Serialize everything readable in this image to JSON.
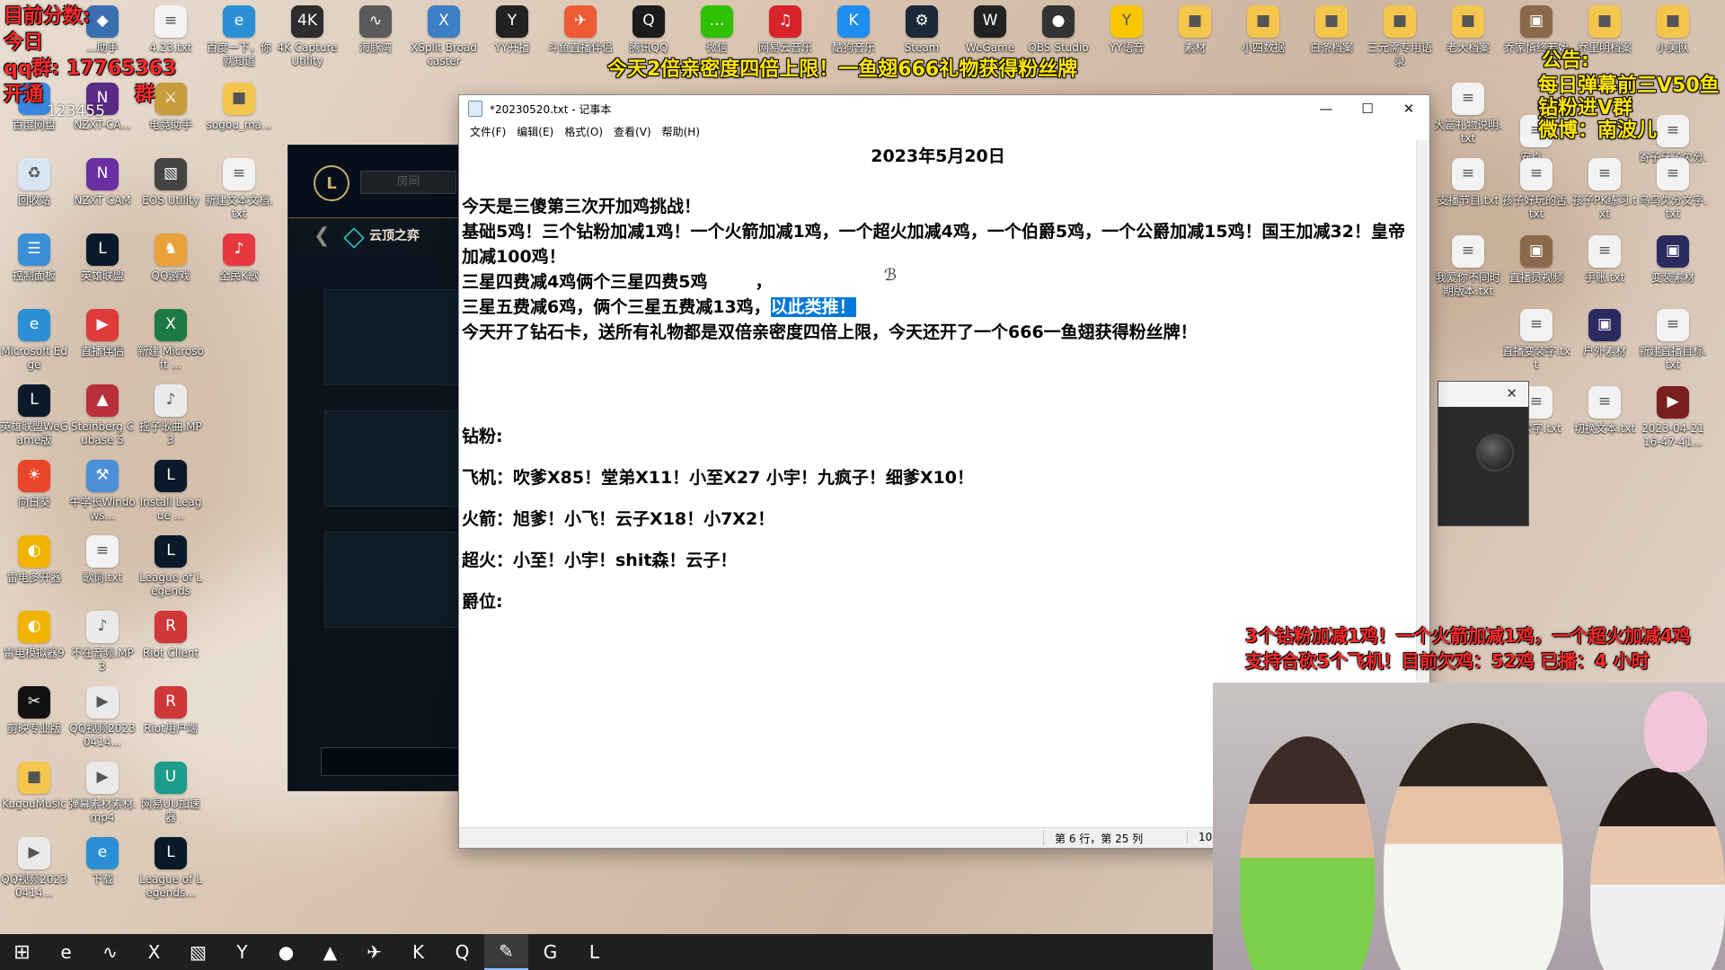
{
  "stream": {
    "score_title": "目前分数:",
    "qq_line": "qq群:   17765363",
    "left_extra_1": "今日",
    "left_extra_2": "开通",
    "left_extra_3": "群",
    "left_number": "123455",
    "top_banner": "今天2倍亲密度四倍上限！一鱼翅666礼物获得粉丝牌",
    "notice_title": "公告:",
    "notice_lines": [
      "每日弹幕前三V50鱼翅",
      "钻粉进V群",
      "微博：南波儿"
    ],
    "bottom_red_1": "3个钻粉加减1鸡！一个火箭加减1鸡，一个超火加减4鸡",
    "bottom_red_2": "支持合砍5个飞机！目前欠鸡：52鸡    已播：4 小时"
  },
  "desktop_top_row": [
    {
      "label": "...助手",
      "icon": "app-icon",
      "color": "#3a6fb0"
    },
    {
      "label": "4.23.txt",
      "icon": "text-file-icon",
      "color": "#f2f2f2"
    },
    {
      "label": "百度一下，你就知道",
      "icon": "edge-icon",
      "color": "#2b8fd6"
    },
    {
      "label": "4K Capture Utility",
      "icon": "capture-icon",
      "color": "#2d2d2d"
    },
    {
      "label": "海豚湾",
      "icon": "dolphin-icon",
      "color": "#5a5a5a"
    },
    {
      "label": "XSplit Broadcaster",
      "icon": "xsplit-icon",
      "color": "#3d7fc4"
    },
    {
      "label": "YY开播",
      "icon": "yy-live-icon",
      "color": "#222"
    },
    {
      "label": "斗鱼直播伴侣",
      "icon": "douyu-icon",
      "color": "#ef5b35"
    },
    {
      "label": "腾讯QQ",
      "icon": "qq-icon",
      "color": "#1a1a1a"
    },
    {
      "label": "微信",
      "icon": "wechat-icon",
      "color": "#2dc100"
    },
    {
      "label": "网易云音乐",
      "icon": "netease-music-icon",
      "color": "#d8232a"
    },
    {
      "label": "酷狗音乐",
      "icon": "kugou-icon",
      "color": "#1f8ef1"
    },
    {
      "label": "Steam",
      "icon": "steam-icon",
      "color": "#1b2838"
    },
    {
      "label": "WeGame",
      "icon": "wegame-icon",
      "color": "#222"
    },
    {
      "label": "OBS Studio",
      "icon": "obs-icon",
      "color": "#333"
    },
    {
      "label": "YY语音",
      "icon": "yy-voice-icon",
      "color": "#f7c600"
    },
    {
      "label": "素材",
      "icon": "folder-icon",
      "color": "#f5c64d"
    },
    {
      "label": "小四数据",
      "icon": "folder-icon",
      "color": "#f5c64d"
    },
    {
      "label": "白条档案",
      "icon": "folder-icon",
      "color": "#f5c64d"
    },
    {
      "label": "三元需专用语录",
      "icon": "folder-icon",
      "color": "#f5c64d"
    },
    {
      "label": "老大档案",
      "icon": "folder-icon",
      "color": "#f5c64d"
    },
    {
      "label": "乔家慎终若始",
      "icon": "archive-icon",
      "color": "#8a6a4a"
    },
    {
      "label": "乔里明档案",
      "icon": "folder-icon",
      "color": "#f5c64d"
    },
    {
      "label": "小美队",
      "icon": "folder-icon",
      "color": "#f5c64d"
    }
  ],
  "desktop_left_cols": [
    {
      "label": "百度网盘",
      "icon": "baidu-pan-icon",
      "color": "#3a86e0"
    },
    {
      "label": "NZXT-CA...",
      "icon": "nzxt-icon",
      "color": "#5b2a86"
    },
    {
      "label": "电竞助手",
      "icon": "esports-icon",
      "color": "#c89b3c"
    },
    {
      "label": "sogou_ma...",
      "icon": "folder-icon",
      "color": "#f5c64d"
    },
    {
      "label": "回收站",
      "icon": "recycle-bin-icon",
      "color": "#d9e6f2"
    },
    {
      "label": "NZXT CAM",
      "icon": "nzxt-icon",
      "color": "#6b2fa3"
    },
    {
      "label": "EOS Utility",
      "icon": "eos-icon",
      "color": "#444"
    },
    {
      "label": "新建文本文档.txt",
      "icon": "text-file-icon",
      "color": "#f2f2f2"
    },
    {
      "label": "控制面板",
      "icon": "control-panel-icon",
      "color": "#3b8fd6"
    },
    {
      "label": "英雄联盟",
      "icon": "lol-icon",
      "color": "#0a1a2a"
    },
    {
      "label": "QQ游戏",
      "icon": "qq-game-icon",
      "color": "#e9a13b"
    },
    {
      "label": "全民K歌",
      "icon": "kge-icon",
      "color": "#e7383f"
    },
    {
      "label": "Microsoft Edge",
      "icon": "edge-icon",
      "color": "#2b8fd6"
    },
    {
      "label": "直播伴侣",
      "icon": "live-companion-icon",
      "color": "#e03b3b"
    },
    {
      "label": "新建 Microsoft ...",
      "icon": "excel-icon",
      "color": "#1d7a45"
    },
    {
      "label": "英雄联盟WeGame版",
      "icon": "lol-icon",
      "color": "#0a1a2a"
    },
    {
      "label": "Steinberg Cubase 5",
      "icon": "cubase-icon",
      "color": "#b8303a"
    },
    {
      "label": "摇子歌曲.MP3",
      "icon": "mp3-icon",
      "color": "#eaeaea"
    },
    {
      "label": "向日葵",
      "icon": "sunflower-icon",
      "color": "#e8452b"
    },
    {
      "label": "牛学长Windows...",
      "icon": "tool-icon",
      "color": "#4a8fd8"
    },
    {
      "label": "Install League ...",
      "icon": "lol-icon",
      "color": "#0a1a2a"
    },
    {
      "label": "雷电多开器",
      "icon": "ldplayer-icon",
      "color": "#f0b400"
    },
    {
      "label": "歌词.txt",
      "icon": "text-file-icon",
      "color": "#f2f2f2"
    },
    {
      "label": "League of Legends",
      "icon": "lol-icon",
      "color": "#0a1a2a"
    },
    {
      "label": "雷电模拟器9",
      "icon": "ldplayer-icon",
      "color": "#f0b400"
    },
    {
      "label": "不在音频.MP3",
      "icon": "mp3-icon",
      "color": "#eaeaea"
    },
    {
      "label": "Riot Client",
      "icon": "riot-icon",
      "color": "#d13639"
    },
    {
      "label": "剪映专业版",
      "icon": "capcut-icon",
      "color": "#111"
    },
    {
      "label": "QQ视频20230414...",
      "icon": "video-file-icon",
      "color": "#eaeaea"
    },
    {
      "label": "Riot用户端",
      "icon": "riot-icon",
      "color": "#d13639"
    },
    {
      "label": "KugouMusic",
      "icon": "folder-icon",
      "color": "#f5c64d"
    },
    {
      "label": "弹幕素材素材.mp4",
      "icon": "video-file-icon",
      "color": "#eaeaea"
    },
    {
      "label": "网易UU加速器",
      "icon": "uu-icon",
      "color": "#1c9c8a"
    },
    {
      "label": "QQ视频20230414...",
      "icon": "video-file-icon",
      "color": "#eaeaea"
    },
    {
      "label": "下载",
      "icon": "edge-icon",
      "color": "#2b8fd6"
    },
    {
      "label": "League of Legends...",
      "icon": "lol-icon",
      "color": "#0a1a2a"
    }
  ],
  "desktop_right_cols": [
    {
      "label": "大富礼物说明.txt",
      "icon": "text-file-icon",
      "color": "#f2f2f2"
    },
    {
      "label": "安卓...",
      "icon": "text-file-icon",
      "color": "#f2f2f2"
    },
    {
      "label": "寄子牙子欠分.txt",
      "icon": "text-file-icon",
      "color": "#f2f2f2"
    },
    {
      "label": "支播节目.txt",
      "icon": "text-file-icon",
      "color": "#f2f2f2"
    },
    {
      "label": "孩子好玩的舌.txt",
      "icon": "text-file-icon",
      "color": "#f2f2f2"
    },
    {
      "label": "孩子PK练习.txt",
      "icon": "text-file-icon",
      "color": "#f2f2f2"
    },
    {
      "label": "乌鸟欠分文字.txt",
      "icon": "text-file-icon",
      "color": "#f2f2f2"
    },
    {
      "label": "我爱你不同时期版本.txt",
      "icon": "text-file-icon",
      "color": "#f2f2f2"
    },
    {
      "label": "直播员视频",
      "icon": "archive-icon",
      "color": "#8a6a4a"
    },
    {
      "label": "手账.txt",
      "icon": "text-file-icon",
      "color": "#f2f2f2"
    },
    {
      "label": "变装素材",
      "icon": "archive-icon",
      "color": "#2b2b60"
    },
    {
      "label": "直播变装字.txt",
      "icon": "text-file-icon",
      "color": "#f2f2f2"
    },
    {
      "label": "户外素材",
      "icon": "archive-icon",
      "color": "#2b2b60"
    },
    {
      "label": "新建直播目标.txt",
      "icon": "text-file-icon",
      "color": "#f2f2f2"
    },
    {
      "label": "...欢字.txt",
      "icon": "text-file-icon",
      "color": "#f2f2f2"
    },
    {
      "label": "切换文本.txt",
      "icon": "text-file-icon",
      "color": "#f2f2f2"
    },
    {
      "label": "2023-04-21 16-47-41...",
      "icon": "video-file-icon",
      "color": "#7a1f1f"
    }
  ],
  "lol_client": {
    "room_placeholder": "房间",
    "mode_title": "云顶之弈"
  },
  "notepad": {
    "title": "*20230520.txt - 记事本",
    "menus": [
      "文件(F)",
      "编辑(E)",
      "格式(O)",
      "查看(V)",
      "帮助(H)"
    ],
    "lines": {
      "date": "2023年5月20日",
      "l1": "今天是三傻第三次开加鸡挑战！",
      "l2": "基础5鸡！三个钻粉加减1鸡！一个火箭加减1鸡，一个超火加减4鸡，一个伯爵5鸡，一个公爵加减15鸡！国王加减32！皇帝加减100鸡！",
      "l3": "三星四费减4鸡俩个三星四费5鸡        ，",
      "l4a": "三星五费减6鸡，俩个三星五费减13鸡，",
      "l4b": "以此类推！",
      "l5": "今天开了钻石卡，送所有礼物都是双倍亲密度四倍上限，今天还开了一个666一鱼翅获得粉丝牌！",
      "zf": "钻粉:",
      "fj": "飞机：吹爹X85！堂弟X11！小至X27 小宇！九疯子！细爹X10！",
      "hj": "火箭：旭爹！小飞！云子X18！小7X2！",
      "ch": "超火：小至！小宇！shit森！云子！",
      "jw": "爵位:"
    },
    "status_position": "第 6 行，第 25 列",
    "status_zoom": "100%",
    "selection_color": "#0078d7"
  },
  "taskbar": {
    "items": [
      "start-icon",
      "edge-icon",
      "dolphin-icon",
      "xsplit-icon",
      "eos-icon",
      "yy-live-icon",
      "obs-icon",
      "cubase-icon",
      "douyu-icon",
      "kugou-icon",
      "qq-icon",
      "notepad-icon",
      "garena-icon",
      "lol-icon"
    ]
  }
}
